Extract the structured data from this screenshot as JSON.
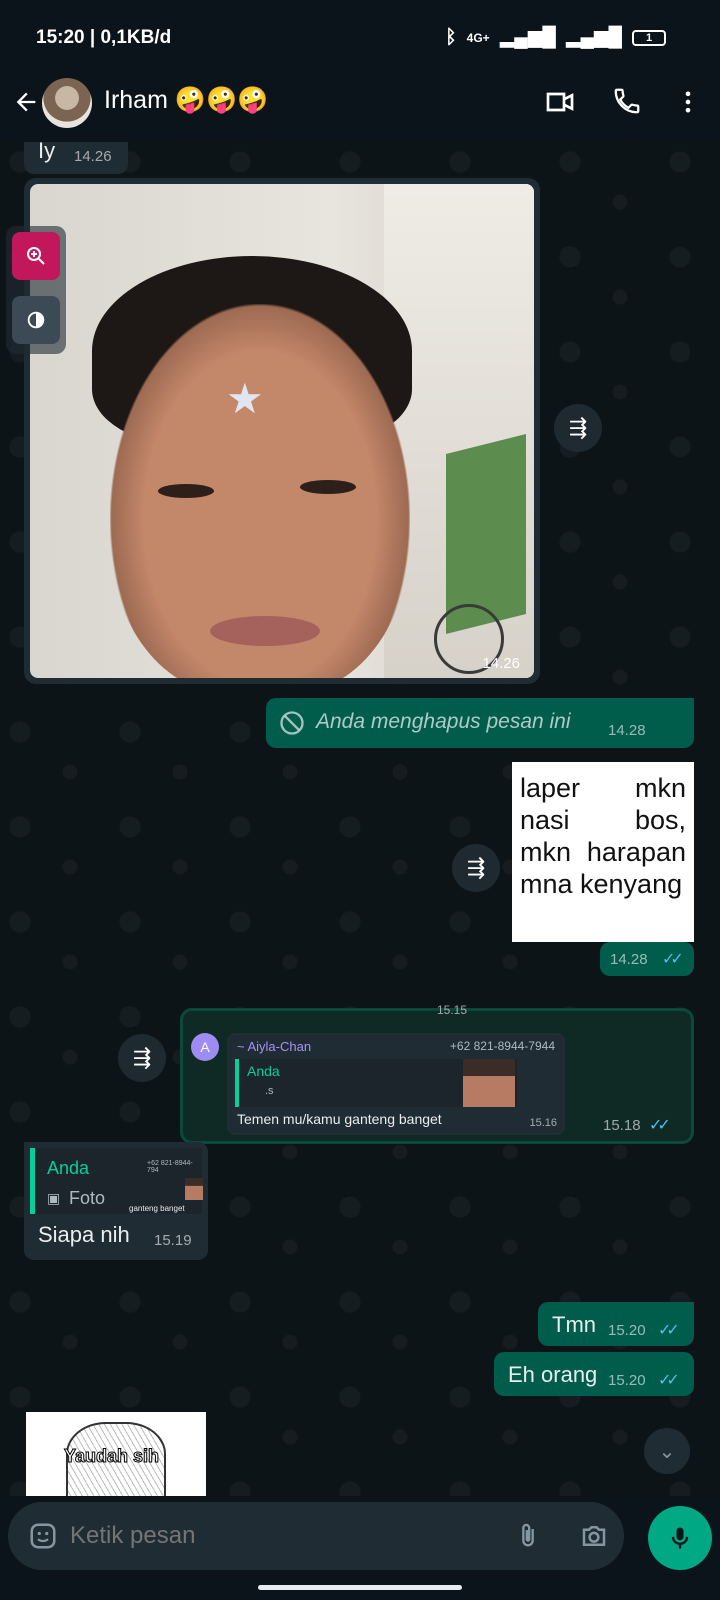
{
  "status": {
    "time": "15:20 | 0,1KB/d",
    "network": "4G+",
    "battery": "1"
  },
  "header": {
    "contact_name": "Irham 🤪🤪🤪"
  },
  "messages": {
    "prev_text": "Iy",
    "prev_time": "14.26",
    "photo_time": "14.26",
    "deleted_text": "Anda menghapus pesan ini",
    "deleted_time": "14.28",
    "image_text": "laper mkn nasi bos, mkn harapan mna kenyang",
    "image_time": "14.28",
    "quoted_time_top": "15.15",
    "fwd_sender": "~ Aiyla-Chan",
    "fwd_phone": "+62 821-8944-7944",
    "fwd_reply_author": "Anda",
    "fwd_reply_label": ".s",
    "fwd_text": "Temen mu/kamu ganteng banget",
    "fwd_inner_time": "15.16",
    "fwd_time": "15.18",
    "reply_author": "Anda",
    "reply_label": "Foto",
    "reply_thumb_text": "ganteng banget",
    "reply_thumb_phone": "+62 821-8944-794",
    "siapa_text": "Siapa nih",
    "siapa_time": "15.19",
    "tmn_text": "Tmn",
    "tmn_time": "15.20",
    "eh_text": "Eh orang",
    "eh_time": "15.20",
    "sticker_text": "Yaudah sih"
  },
  "input": {
    "placeholder": "Ketik pesan"
  },
  "colors": {
    "accent": "#00a884",
    "outgoing": "#005c4b",
    "incoming": "#202c33",
    "ticks": "#53bdeb"
  }
}
